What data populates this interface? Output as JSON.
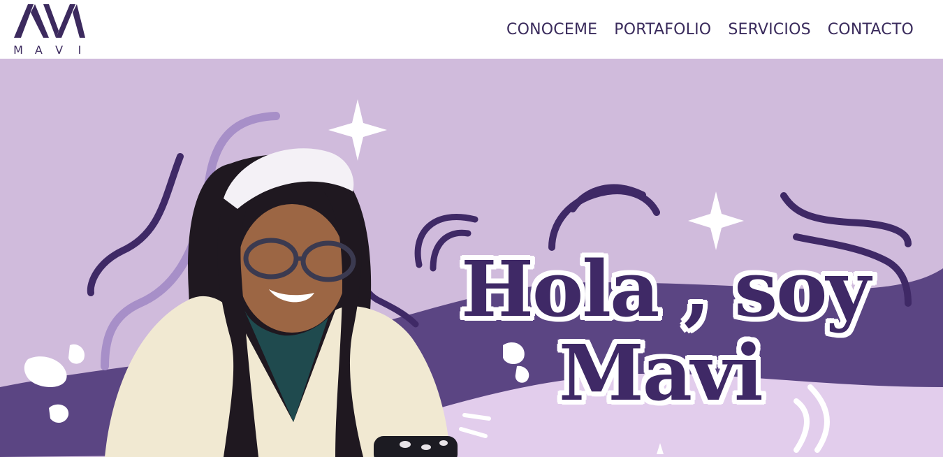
{
  "brand": {
    "logo_text": "M A V I",
    "logo_letters": [
      "M",
      "A",
      "V",
      "I"
    ]
  },
  "nav": {
    "items": [
      {
        "label": "CONOCEME"
      },
      {
        "label": "PORTAFOLIO"
      },
      {
        "label": "SERVICIOS"
      },
      {
        "label": "CONTACTO"
      }
    ]
  },
  "hero": {
    "title_line1": "Hola , soy",
    "title_line2": "Mavi"
  },
  "colors": {
    "brand_purple": "#3c2a5e",
    "hero_bg": "#d0bbdc",
    "wave_dark": "#5b4583",
    "wave_light": "#e2cdec",
    "title_fill": "#3f2966"
  }
}
